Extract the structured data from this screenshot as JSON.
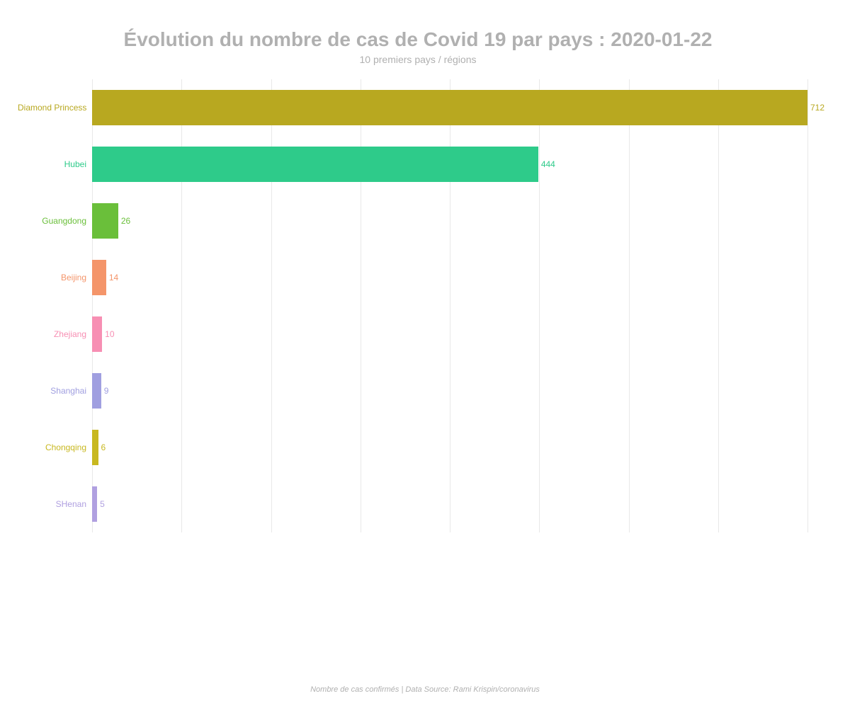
{
  "title": "Évolution du nombre de cas de Covid 19 par pays : 2020-01-22",
  "subtitle": "10 premiers pays / régions",
  "footer": "Nombre de cas confirmés | Data Source: Rami Krispin/coronavirus",
  "maxValue": 712,
  "bars": [
    {
      "label": "Diamond Princess",
      "value": 712,
      "color": "#b8a820",
      "labelColor": "#b8a820"
    },
    {
      "label": "Hubei",
      "value": 444,
      "color": "#2ecb8a",
      "labelColor": "#2ecb8a"
    },
    {
      "label": "Guangdong",
      "value": 26,
      "color": "#6abf3a",
      "labelColor": "#6abf3a"
    },
    {
      "label": "Beijing",
      "value": 14,
      "color": "#f4956a",
      "labelColor": "#f4956a"
    },
    {
      "label": "Zhejiang",
      "value": 10,
      "color": "#f78fb3",
      "labelColor": "#f78fb3"
    },
    {
      "label": "Shanghai",
      "value": 9,
      "color": "#a09fe0",
      "labelColor": "#a09fe0"
    },
    {
      "label": "Chongqing",
      "value": 6,
      "color": "#c8b820",
      "labelColor": "#c8b820"
    },
    {
      "label": "SHenan",
      "value": 5,
      "color": "#b0a0e0",
      "labelColor": "#b0a0e0"
    }
  ],
  "gridLines": [
    0,
    142.4,
    284.8,
    427.2,
    569.6,
    712,
    854.4,
    996.8,
    1070
  ]
}
